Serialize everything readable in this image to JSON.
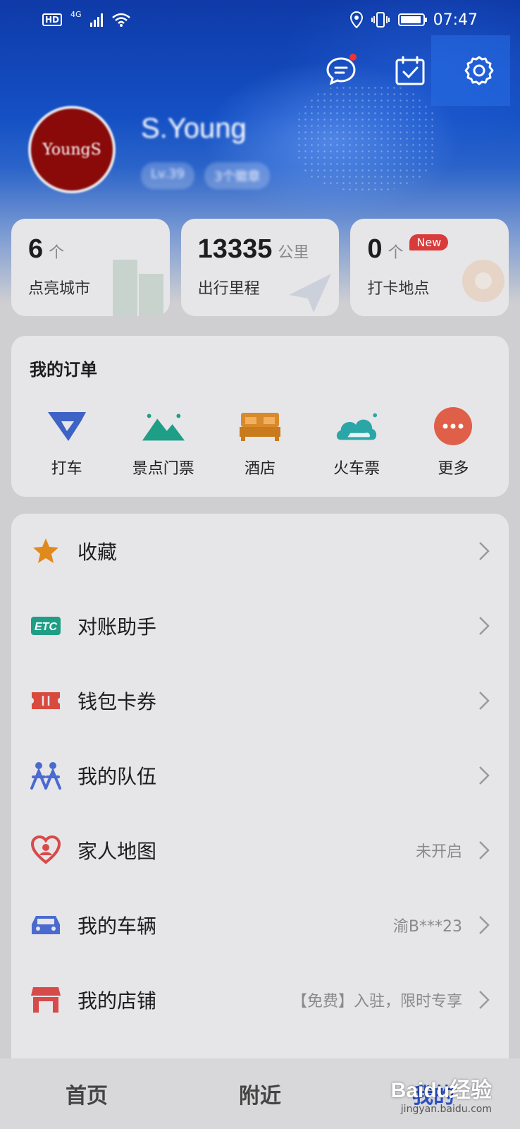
{
  "status_bar": {
    "hd_label": "HD",
    "network_label": "4G",
    "time": "07:47"
  },
  "profile": {
    "avatar_text": "YoungS",
    "username": "S.Young",
    "level": "Lv.39",
    "medals": "3个徽章"
  },
  "stats": [
    {
      "value": "6",
      "unit": "个",
      "label": "点亮城市"
    },
    {
      "value": "13335",
      "unit": "公里",
      "label": "出行里程"
    },
    {
      "value": "0",
      "unit": "个",
      "label": "打卡地点",
      "badge": "New"
    }
  ],
  "orders": {
    "title": "我的订单",
    "items": [
      {
        "label": "打车",
        "icon": "taxi-icon"
      },
      {
        "label": "景点门票",
        "icon": "mountain-icon"
      },
      {
        "label": "酒店",
        "icon": "bed-icon"
      },
      {
        "label": "火车票",
        "icon": "cloud-train-icon"
      },
      {
        "label": "更多",
        "icon": "more-icon"
      }
    ]
  },
  "menu": [
    {
      "label": "收藏",
      "extra": "",
      "icon": "star-icon"
    },
    {
      "label": "对账助手",
      "extra": "",
      "icon": "etc-icon"
    },
    {
      "label": "钱包卡券",
      "extra": "",
      "icon": "ticket-icon"
    },
    {
      "label": "我的队伍",
      "extra": "",
      "icon": "team-icon"
    },
    {
      "label": "家人地图",
      "extra": "未开启",
      "icon": "heart-location-icon"
    },
    {
      "label": "我的车辆",
      "extra": "渝B***23",
      "icon": "car-icon"
    },
    {
      "label": "我的店铺",
      "extra": "【免费】入驻，限时专享",
      "icon": "store-icon"
    }
  ],
  "bottom_nav": {
    "tab_home": "首页",
    "tab_nearby": "附近",
    "tab_me": "我的"
  },
  "watermark": {
    "main": "Baidu经验",
    "sub": "jingyan.baidu.com"
  },
  "colors": {
    "header_blue": "#1450c4",
    "accent_red": "#d93a3a",
    "card_bg": "#e6e6e8"
  }
}
